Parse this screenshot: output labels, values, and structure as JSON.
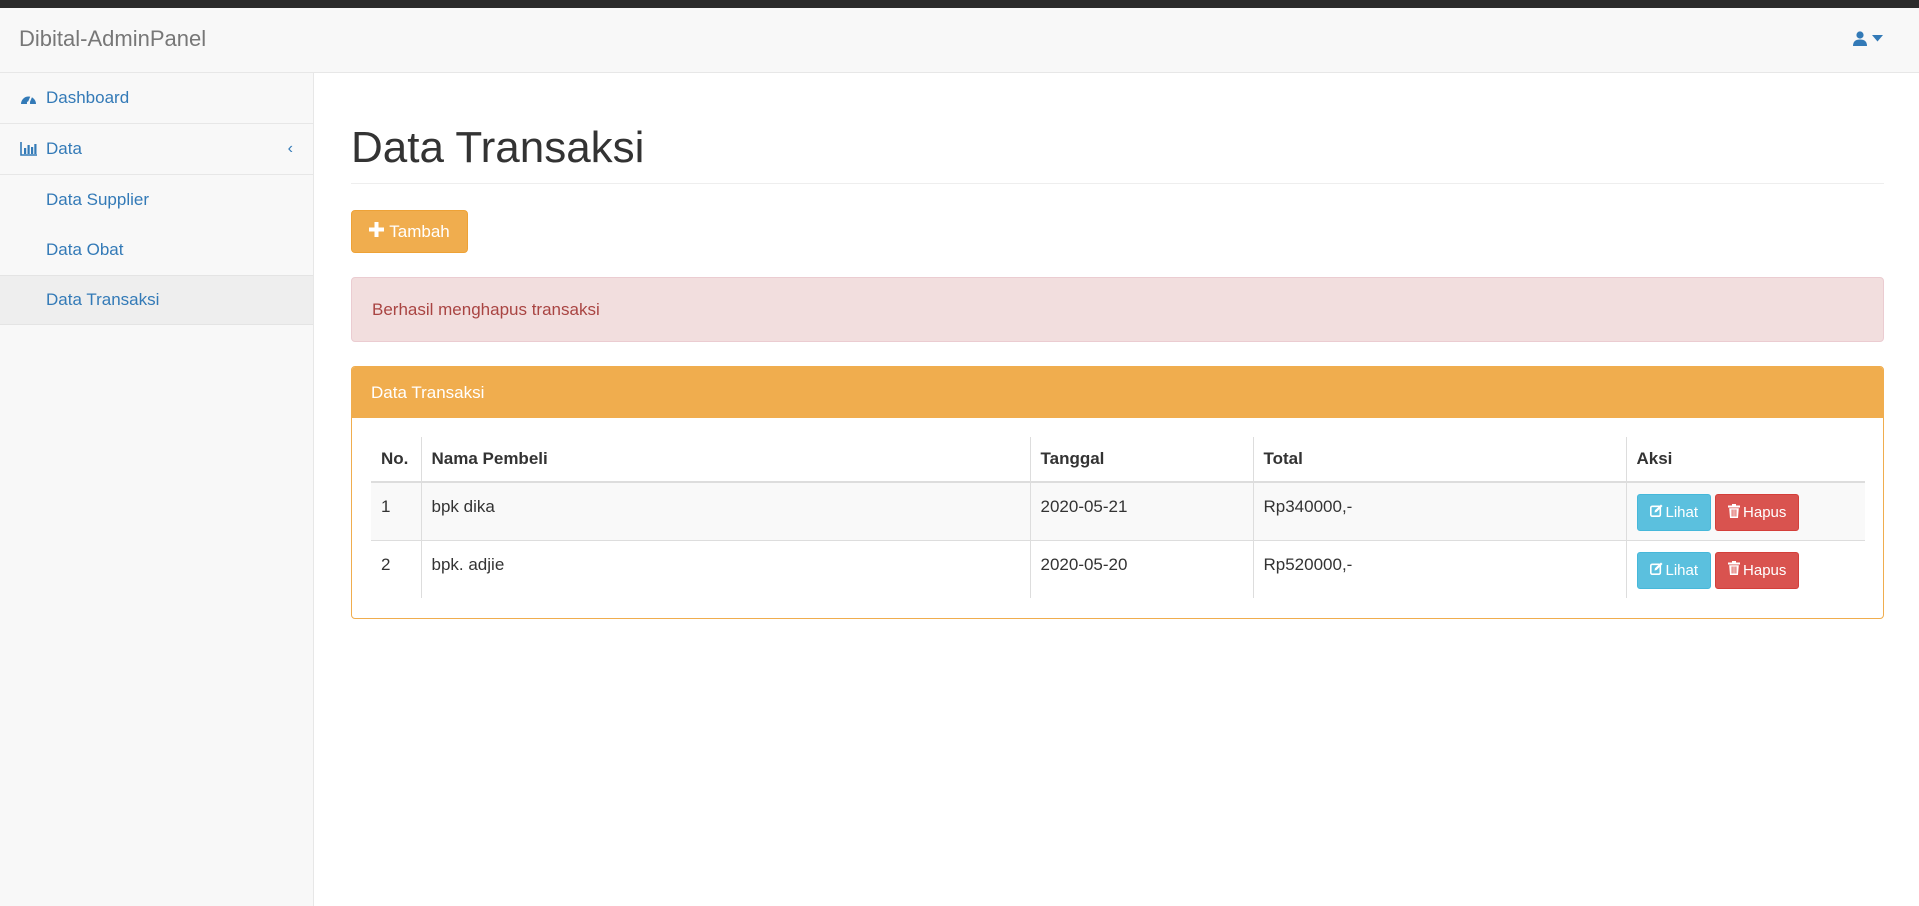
{
  "navbar": {
    "brand": "Dibital-AdminPanel",
    "user_icon": "user-icon"
  },
  "sidebar": {
    "dashboard": {
      "label": "Dashboard",
      "icon": "dashboard-icon"
    },
    "data": {
      "label": "Data",
      "icon": "bar-chart-icon",
      "caret": "‹"
    },
    "sub_items": [
      {
        "label": "Data Supplier"
      },
      {
        "label": "Data Obat"
      },
      {
        "label": "Data Transaksi",
        "active": true
      }
    ]
  },
  "main": {
    "title": "Data Transaksi",
    "add_button": "Tambah",
    "alert": "Berhasil menghapus transaksi",
    "panel_title": "Data Transaksi",
    "table": {
      "headers": [
        "No.",
        "Nama Pembeli",
        "Tanggal",
        "Total",
        "Aksi"
      ],
      "rows": [
        {
          "no": "1",
          "nama": "bpk dika",
          "tanggal": "2020-05-21",
          "total": "Rp340000,-"
        },
        {
          "no": "2",
          "nama": "bpk. adjie",
          "tanggal": "2020-05-20",
          "total": "Rp520000,-"
        }
      ],
      "view_label": "Lihat",
      "delete_label": "Hapus"
    }
  },
  "colors": {
    "accent": "#337ab7",
    "warning": "#f0ad4e",
    "info": "#5bc0de",
    "danger": "#d9534f",
    "alert_bg": "#f2dede"
  }
}
